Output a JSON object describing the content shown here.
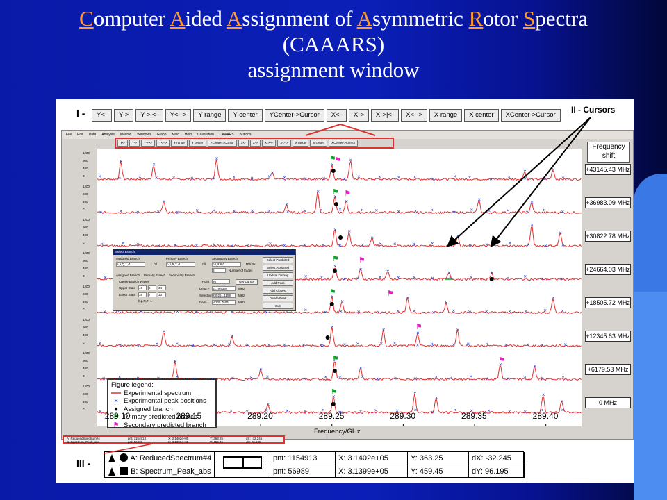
{
  "slide": {
    "title": {
      "segments": [
        {
          "t": "C",
          "u": true
        },
        {
          "t": "omputer ",
          "u": false
        },
        {
          "t": "A",
          "u": true
        },
        {
          "t": "ided ",
          "u": false
        },
        {
          "t": "A",
          "u": true
        },
        {
          "t": "ssignment of ",
          "u": false
        },
        {
          "t": "A",
          "u": true
        },
        {
          "t": "symmetric ",
          "u": false
        },
        {
          "t": "R",
          "u": true
        },
        {
          "t": "otor ",
          "u": false
        },
        {
          "t": "S",
          "u": true
        },
        {
          "t": "pectra",
          "u": false
        }
      ],
      "line2": "(CAAARS)",
      "line3": "assignment window"
    },
    "colors": {
      "background": "#0b1fb8",
      "title_text": "#ffffff",
      "title_accent": "#ff9a33"
    }
  },
  "labels": {
    "roman1": "I -",
    "roman2": "II - Cursors",
    "roman3": "III -"
  },
  "big_toolbar": [
    "Y<-",
    "Y->",
    "Y->|<-",
    "Y<-->",
    "Y range",
    "Y center",
    "YCenter->Cursor",
    "X<-",
    "X->",
    "X->|<-",
    "X<-->",
    "X range",
    "X center",
    "XCenter->Cursor"
  ],
  "menu": [
    "File",
    "Edit",
    "Data",
    "Analysis",
    "Macros",
    "Windows",
    "Graph",
    "Misc",
    "Help",
    "Calibration",
    "CAAARS",
    "Buttons"
  ],
  "frequency_header": "Frequency shift",
  "frequency_shifts": [
    "+43145.43 MHz",
    "+36983.09 MHz",
    "+30822.78 MHz",
    "+24664.03 MHz",
    "+18505.72 MHz",
    "+12345.63 MHz",
    "+6179.53 MHz",
    "0 MHz"
  ],
  "y_tick_labels": [
    "1200",
    "800",
    "400",
    "0"
  ],
  "x_ticks": [
    "289.10",
    "289.15",
    "289.20",
    "289.25",
    "289.30",
    "289.35",
    "289.40"
  ],
  "x_axis_label": "Frequency/GHz",
  "legend": {
    "title": "Figure legend:",
    "items": [
      {
        "label": "Experimental spectrum",
        "symbol": "line",
        "color": "#e03030"
      },
      {
        "label": "Experimental peak positions",
        "symbol": "x",
        "color": "#2244cc"
      },
      {
        "label": "Assigned branch",
        "symbol": "dot",
        "color": "#000000"
      },
      {
        "label": "Primary predicted branch",
        "symbol": "flag",
        "color": "#14a028"
      },
      {
        "label": "Secondary predicted branch",
        "symbol": "flag",
        "color": "#e020c0"
      }
    ]
  },
  "dialog": {
    "title": "Select Branch",
    "assigned_branch": "Assigned Branch",
    "assigned_value": "a,a,Q,1,-1",
    "primary_branch": "Primary Branch",
    "primary_value": "b,p,R,7,-1",
    "secondary_branch": "Secondary Branch",
    "secondary_value": "b,r,R,6,0",
    "all": "All",
    "yes_no": "Yes/No",
    "number_of_traces_label": "Number of traces",
    "number_of_traces": "8",
    "tabs": [
      "Assigned Branch",
      "Primary Branch",
      "Secondary Branch"
    ],
    "create_branch_waves": "Create Branch Waves",
    "upper_state": "Upper State",
    "upper_values": [
      "40",
      "6",
      "34"
    ],
    "lower_state": "Lower State",
    "lower_values": [
      "39",
      "7",
      "33"
    ],
    "state_label": "b,p,R,7,-1",
    "point_label": "Point",
    "point_value": "26",
    "get_cursor": "Get Cursor",
    "delta_plus": "Delta +",
    "delta_plus_value": "6179.5394",
    "selected": "Selected",
    "selected_value": "289251.1159",
    "delta_minus": "Delta -",
    "delta_minus_value": "-6205.7604",
    "mhz": "MHz",
    "buttons": [
      "Select Predicted",
      "Select Assigned",
      "Update Display",
      "Add Peak",
      "Add Closest",
      "Delete Peak",
      "Exit"
    ]
  },
  "status_small": {
    "rowA": "A: ReducedSpectrum#4",
    "rowB": "B: Spectrum_Peak_abs",
    "pntA": "pnt: 1154913",
    "xA": "X: 3.1402e+05",
    "yA": "Y: 363.25",
    "dX": "dX: -32.245",
    "pntB": "pnt: 56989",
    "xB": "X: 3.1399e+05",
    "yB": "Y: 459.45",
    "dY": "dY: 96.195"
  },
  "status_big": {
    "rowA": "A: ReducedSpectrum#4",
    "rowB": "B: Spectrum_Peak_abs",
    "pntA": "pnt: 1154913",
    "xA": "X: 3.1402e+05",
    "yA": "Y: 363.25",
    "dX": "dX: -32.245",
    "pntB": "pnt: 56989",
    "xB": "X: 3.1399e+05",
    "yB": "Y: 459.45",
    "dY": "dY: 96.195"
  },
  "chart_data": {
    "type": "line",
    "xlabel": "Frequency/GHz",
    "xlim": [
      289.085,
      289.425
    ],
    "x_ticks": [
      289.1,
      289.15,
      289.2,
      289.25,
      289.3,
      289.35,
      289.4
    ],
    "series": [
      {
        "name": "+43145.43 MHz",
        "peaks": [
          [
            289.102,
            1100
          ],
          [
            289.125,
            900
          ],
          [
            289.169,
            1300
          ],
          [
            289.208,
            400
          ],
          [
            289.25,
            900
          ],
          [
            289.263,
            1200
          ],
          [
            289.385,
            500
          ],
          [
            289.405,
            600
          ]
        ]
      },
      {
        "name": "+36983.09 MHz",
        "peaks": [
          [
            289.132,
            700
          ],
          [
            289.218,
            500
          ],
          [
            289.24,
            1300
          ],
          [
            289.252,
            1000
          ],
          [
            289.26,
            700
          ],
          [
            289.353,
            800
          ],
          [
            289.39,
            600
          ]
        ]
      },
      {
        "name": "+30822.78 MHz",
        "peaks": [
          [
            289.252,
            1000
          ],
          [
            289.262,
            900
          ],
          [
            289.278,
            500
          ],
          [
            289.338,
            600
          ],
          [
            289.39,
            1300
          ],
          [
            289.41,
            800
          ]
        ]
      },
      {
        "name": "+24664.03 MHz",
        "peaks": [
          [
            289.252,
            800
          ],
          [
            289.27,
            600
          ],
          [
            289.289,
            500
          ],
          [
            289.332,
            400
          ],
          [
            289.362,
            400
          ]
        ]
      },
      {
        "name": "+18505.72 MHz",
        "peaks": [
          [
            289.142,
            1300
          ],
          [
            289.178,
            700
          ],
          [
            289.25,
            1000
          ],
          [
            289.257,
            700
          ],
          [
            289.303,
            900
          ],
          [
            289.33,
            600
          ],
          [
            289.405,
            900
          ]
        ]
      },
      {
        "name": "+12345.63 MHz",
        "peaks": [
          [
            289.132,
            900
          ],
          [
            289.18,
            600
          ],
          [
            289.25,
            1200
          ],
          [
            289.286,
            1000
          ],
          [
            289.31,
            800
          ],
          [
            289.338,
            1000
          ]
        ]
      },
      {
        "name": "+6179.53 MHz",
        "peaks": [
          [
            289.14,
            1100
          ],
          [
            289.2,
            600
          ],
          [
            289.252,
            1200
          ],
          [
            289.27,
            700
          ],
          [
            289.368,
            900
          ],
          [
            289.392,
            800
          ]
        ]
      },
      {
        "name": "0 MHz",
        "peaks": [
          [
            289.13,
            600
          ],
          [
            289.205,
            500
          ],
          [
            289.251,
            1000
          ],
          [
            289.308,
            1200
          ],
          [
            289.323,
            900
          ],
          [
            289.398,
            1100
          ],
          [
            289.411,
            700
          ]
        ]
      }
    ],
    "assigned_branch_peaks": [
      [
        289.251,
        0
      ],
      [
        289.253,
        1
      ],
      [
        289.256,
        2
      ],
      [
        289.252,
        3
      ],
      [
        289.25,
        4
      ],
      [
        289.247,
        5
      ],
      [
        289.252,
        6
      ],
      [
        289.251,
        7
      ]
    ],
    "primary_predicted": [
      [
        289.25,
        0
      ],
      [
        289.252,
        1
      ],
      [
        289.252,
        3
      ],
      [
        289.25,
        4
      ],
      [
        289.252,
        6
      ],
      [
        289.251,
        7
      ]
    ],
    "secondary_predicted": [
      [
        289.253,
        0
      ],
      [
        289.26,
        1
      ],
      [
        289.27,
        3
      ],
      [
        289.29,
        4
      ],
      [
        289.31,
        5
      ],
      [
        289.368,
        6
      ]
    ]
  }
}
